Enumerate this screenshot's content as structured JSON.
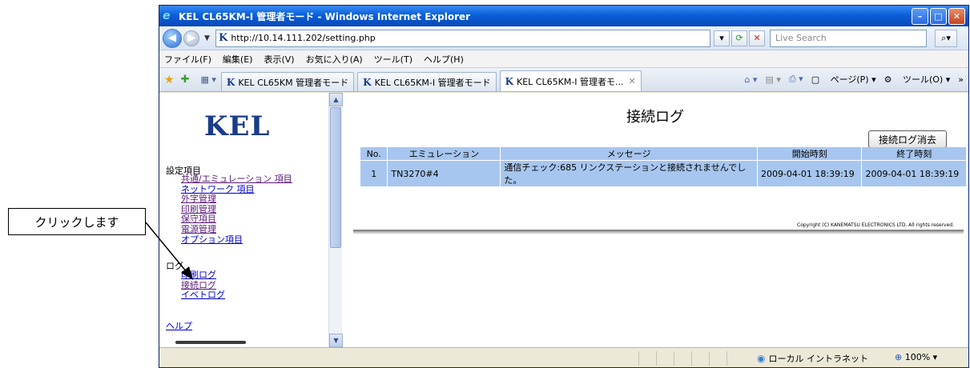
{
  "window": {
    "title": "KEL CL65KM-I 管理者モード - Windows Internet Explorer",
    "minimize": "–",
    "maximize": "□",
    "close": "✕"
  },
  "address": {
    "url": "http://10.14.111.202/setting.php",
    "search_placeholder": "Live Search"
  },
  "menubar": [
    "ファイル(F)",
    "編集(E)",
    "表示(V)",
    "お気に入り(A)",
    "ツール(T)",
    "ヘルプ(H)"
  ],
  "tabs": [
    {
      "label": "KEL CL65KM 管理者モード"
    },
    {
      "label": "KEL CL65KM-I 管理者モード"
    },
    {
      "label": "KEL CL65KM-I 管理者モ..."
    }
  ],
  "tab_tools": {
    "page": "ページ(P)",
    "tools": "ツール(O)"
  },
  "left": {
    "logo": "KEL",
    "settings_title": "設定項目",
    "settings_items": [
      "共通/エミュレーション 項目",
      "ネットワーク 項目",
      "外字管理",
      "印刷管理",
      "保守項目",
      "電源管理",
      "オプション項目"
    ],
    "log_title": "ログ",
    "log_items": [
      "印刷ログ",
      "接続ログ",
      "イベトログ"
    ],
    "help": "ヘルプ"
  },
  "main": {
    "title": "接続ログ",
    "clear_button": "接続ログ消去",
    "columns": [
      "No.",
      "エミュレーション",
      "メッセージ",
      "開始時刻",
      "終了時刻"
    ],
    "rows": [
      {
        "no": "1",
        "emulation": "TN3270#4",
        "message": "通信チェック:685 リンクステーションと接続されませんでした。",
        "start": "2009-04-01 18:39:19",
        "end": "2009-04-01 18:39:19"
      }
    ],
    "copyright": "Copyright (C) KANEMATSU ELECTRONICS LTD. All rights reserved."
  },
  "status": {
    "zone": "ローカル イントラネット",
    "zoom": "100%"
  },
  "callout": {
    "text": "クリックします"
  }
}
